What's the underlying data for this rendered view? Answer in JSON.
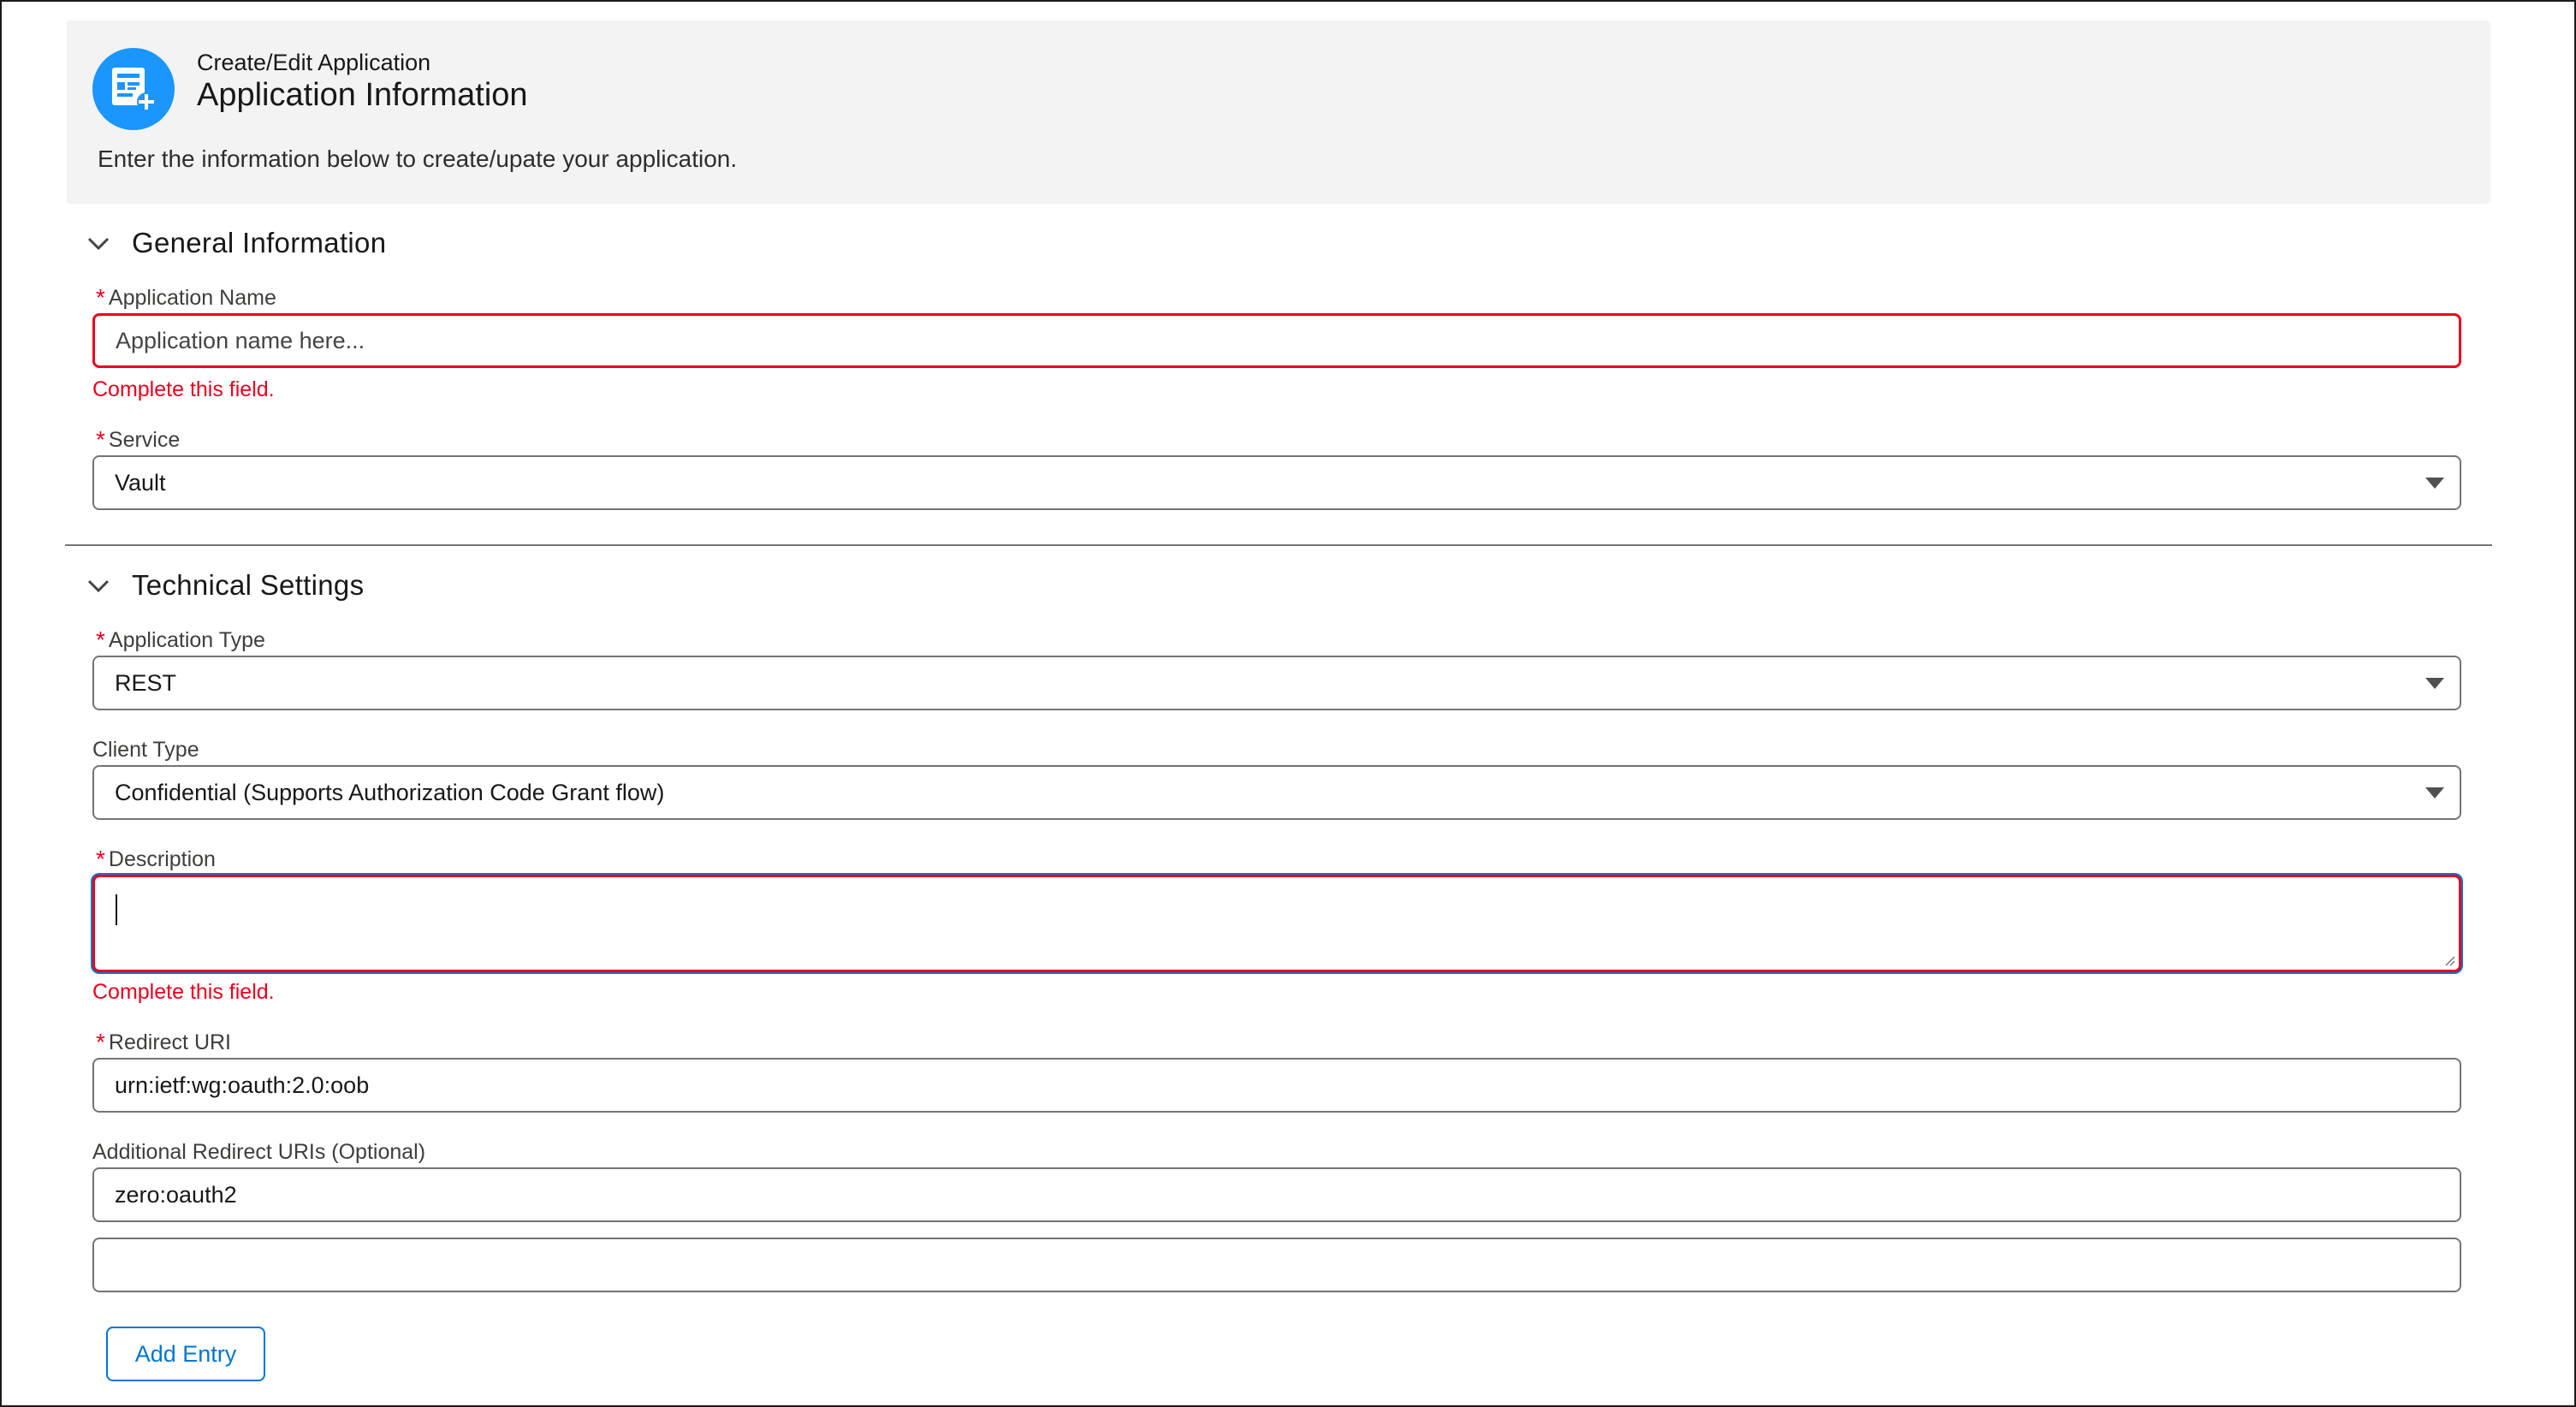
{
  "header": {
    "eyebrow": "Create/Edit Application",
    "title": "Application Information",
    "description": "Enter the information below to create/upate your application.",
    "icon": "app-form-add-icon"
  },
  "sections": {
    "general": {
      "title": "General Information",
      "app_name": {
        "label": "Application Name",
        "placeholder": "Application name here...",
        "value": "",
        "error": "Complete this field."
      },
      "service": {
        "label": "Service",
        "value": "Vault"
      }
    },
    "technical": {
      "title": "Technical Settings",
      "app_type": {
        "label": "Application Type",
        "value": "REST"
      },
      "client_type": {
        "label": "Client Type",
        "value": "Confidential (Supports Authorization Code Grant flow)"
      },
      "description": {
        "label": "Description",
        "value": "",
        "error": "Complete this field."
      },
      "redirect_uri": {
        "label": "Redirect URI",
        "value": "urn:ietf:wg:oauth:2.0:oob"
      },
      "additional_redirect": {
        "label": "Additional Redirect URIs (Optional)",
        "entries": [
          "zero:oauth2",
          ""
        ]
      },
      "add_entry_label": "Add Entry"
    }
  },
  "required_marker": "*",
  "colors": {
    "accent": "#0176d3",
    "icon_bg": "#1b96ff",
    "error": "#ea001e",
    "header_bg": "#f3f3f3"
  }
}
